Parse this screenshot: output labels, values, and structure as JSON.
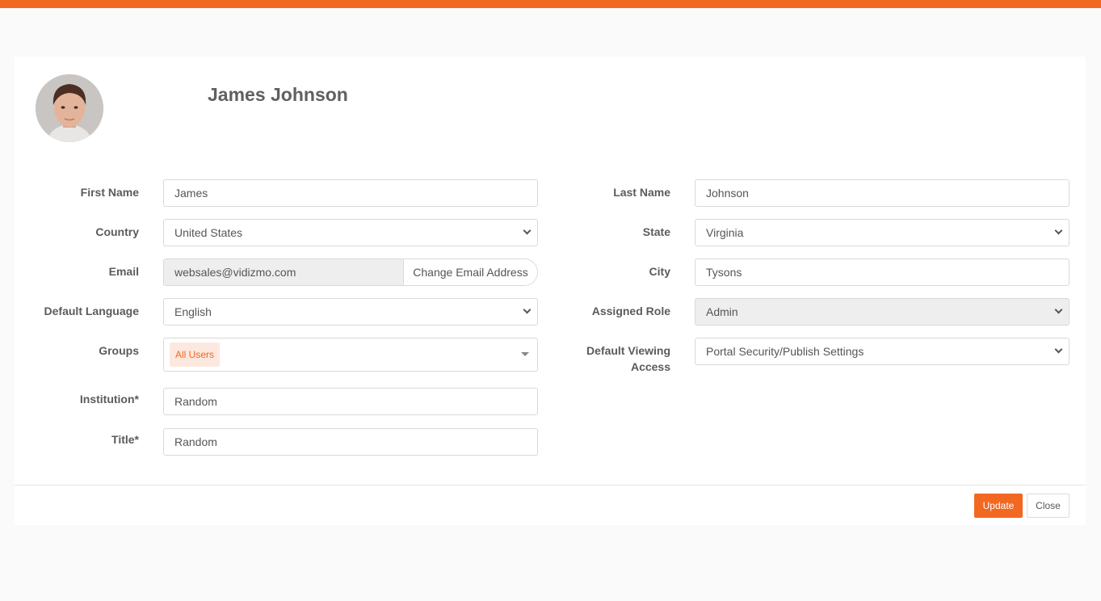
{
  "profile": {
    "name": "James Johnson"
  },
  "form": {
    "first_name": {
      "label": "First Name",
      "value": "James"
    },
    "last_name": {
      "label": "Last Name",
      "value": "Johnson"
    },
    "country": {
      "label": "Country",
      "value": "United States"
    },
    "state": {
      "label": "State",
      "value": "Virginia"
    },
    "email": {
      "label": "Email",
      "value": "websales@vidizmo.com",
      "change_label": "Change Email Address"
    },
    "city": {
      "label": "City",
      "value": "Tysons"
    },
    "default_language": {
      "label": "Default Language",
      "value": "English"
    },
    "assigned_role": {
      "label": "Assigned Role",
      "value": "Admin"
    },
    "groups": {
      "label": "Groups",
      "tags": [
        "All Users"
      ]
    },
    "default_viewing_access": {
      "label_line1": "Default Viewing",
      "label_line2": "Access",
      "value": "Portal Security/Publish Settings"
    },
    "institution": {
      "label": "Institution*",
      "value": "Random"
    },
    "title": {
      "label": "Title*",
      "value": "Random"
    }
  },
  "actions": {
    "update_label": "Update",
    "close_label": "Close"
  },
  "colors": {
    "accent": "#f26722",
    "tag_bg": "#fde8e0"
  }
}
